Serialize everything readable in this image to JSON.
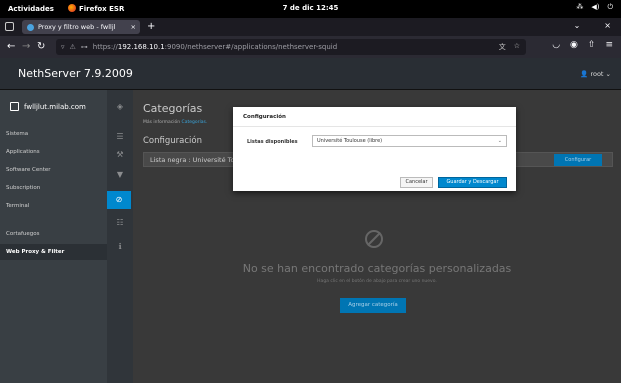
{
  "gnome": {
    "activities": "Actividades",
    "app": "Firefox ESR",
    "clock": "7 de dic  12:45"
  },
  "firefox": {
    "tab_title": "Proxy y filtro web - fwlljl",
    "url_prefix": "https://",
    "url_host": "192.168.10.1",
    "url_rest": ":9090/nethserver#/applications/nethserver-squid"
  },
  "header": {
    "brand": "NethServer 7.9.2009",
    "user": "root"
  },
  "sidebar": {
    "host": "fwlljlut.milab.com",
    "items": [
      {
        "label": "Sistema"
      },
      {
        "label": "Applications"
      },
      {
        "label": "Software Center"
      },
      {
        "label": "Subscription"
      },
      {
        "label": "Terminal"
      },
      {
        "label": "Cortafuegos"
      },
      {
        "label": "Web Proxy & Filter"
      }
    ]
  },
  "main": {
    "title": "Categorías",
    "more_info_prefix": "Más información",
    "more_info_link": "Categorías.",
    "section": "Configuración",
    "list_text": "Lista negra : Université Tou",
    "configure_label": "Configurar",
    "empty_title": "No se han encontrado categorías personalizadas",
    "empty_sub": "Haga clic en el botón de abajo para crear uno nuevo.",
    "add_label": "Agregar categoría"
  },
  "modal": {
    "title": "Configuración",
    "field_label": "Listas disponibles",
    "selected": "Université Toulouse (libre)",
    "cancel": "Cancelar",
    "save": "Guardar y Descargar"
  },
  "colors": {
    "accent": "#0088ce",
    "sidebar": "#393f44",
    "overlay": "#393939"
  }
}
